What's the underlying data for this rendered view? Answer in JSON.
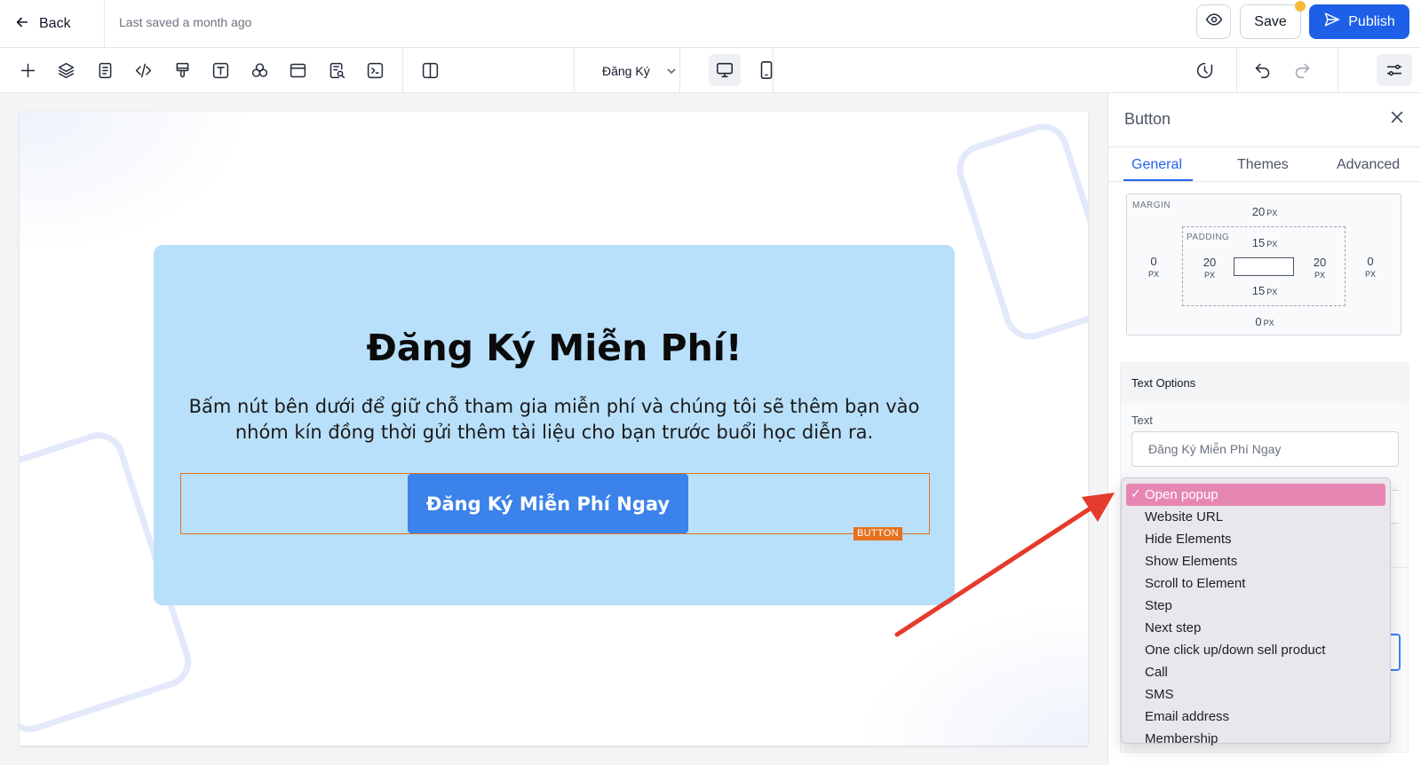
{
  "topbar": {
    "back_label": "Back",
    "saved_status": "Last saved a month ago",
    "save_label": "Save",
    "publish_label": "Publish"
  },
  "toolbar": {
    "tools": [
      "plus-icon",
      "layers-icon",
      "page-icon",
      "code-icon",
      "brush-icon",
      "text-icon",
      "elements-icon",
      "section-icon",
      "search-doc-icon",
      "terminal-icon",
      "columns-icon"
    ],
    "page_select_value": "Đăng Ký",
    "device_active": "desktop"
  },
  "canvas": {
    "headline": "Đăng Ký Miễn Phí!",
    "subtext": "Bấm nút bên dưới để giữ chỗ tham gia miễn phí và chúng tôi sẽ thêm bạn vào nhóm kín đồng thời gửi thêm tài liệu cho bạn trước buổi học diễn ra.",
    "cta_label": "Đăng Ký Miễn Phí Ngay",
    "selection_tag": "BUTTON",
    "colors": {
      "section_bg": "#b9e0fa",
      "cta_bg": "#3b83ea",
      "selection": "#e4711d"
    }
  },
  "panel": {
    "title": "Button",
    "tabs": [
      "General",
      "Themes",
      "Advanced"
    ],
    "active_tab": "General",
    "spacing": {
      "margin_label": "MARGIN",
      "padding_label": "PADDING",
      "unit": "PX",
      "margin_top": "20",
      "margin_right": "0",
      "margin_bottom": "0",
      "margin_left": "0",
      "padding_top": "15",
      "padding_right": "20",
      "padding_bottom": "15",
      "padding_left": "20"
    },
    "text_options": {
      "title": "Text Options",
      "text_label": "Text",
      "text_value": "Đăng Ký Miễn Phí Ngay"
    }
  },
  "dropdown": {
    "selected": "Open popup",
    "check": "✓",
    "options": [
      "Open popup",
      "Website URL",
      "Hide Elements",
      "Show Elements",
      "Scroll to Element",
      "Step",
      "Next step",
      "One click up/down sell product",
      "Call",
      "SMS",
      "Email address",
      "Membership"
    ]
  },
  "annotation": {
    "arrow_color": "#e53b2c"
  }
}
